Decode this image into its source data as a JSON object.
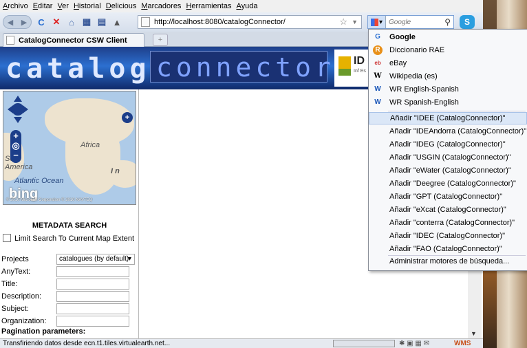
{
  "menubar": {
    "items": [
      "Archivo",
      "Editar",
      "Ver",
      "Historial",
      "Delicious",
      "Marcadores",
      "Herramientas",
      "Ayuda"
    ]
  },
  "navbar": {
    "url": "http://localhost:8080/catalogConnector/",
    "search_placeholder": "Google"
  },
  "tabs": {
    "active_title": "CatalogConnector CSW Client",
    "new_tab_label": "+"
  },
  "banner": {
    "logo_part1": "catalog",
    "logo_part2": "connector",
    "ide_title": "ID",
    "ide_sub": "Inf Es"
  },
  "map": {
    "labels": {
      "africa": "Africa",
      "america": "America",
      "ocean": "Atlantic Ocean",
      "in": "I n",
      "se": "Se"
    },
    "brand": "bing",
    "copyright": "© 2010 Microsoft Corporation   © 2010 NAVTEQ"
  },
  "search": {
    "title": "METADATA SEARCH",
    "limit_label": "Limit Search To Current Map Extent",
    "fields": [
      {
        "label": "Projects",
        "value": "catalogues (by default)"
      },
      {
        "label": "AnyText:"
      },
      {
        "label": "Title:"
      },
      {
        "label": "Description:"
      },
      {
        "label": "Subject:"
      },
      {
        "label": "Organization:"
      }
    ],
    "pagination_label": "Pagination parameters:"
  },
  "status": {
    "text": "Transfiriendo datos desde ecn.t1.tiles.virtualearth.net...",
    "wms": "WMS"
  },
  "dropdown": {
    "engines": [
      {
        "label": "Google",
        "icon": "google-icon"
      },
      {
        "label": "Diccionario RAE",
        "icon": "rae-icon"
      },
      {
        "label": "eBay",
        "icon": "ebay-icon"
      },
      {
        "label": "Wikipedia (es)",
        "icon": "wikipedia-icon"
      },
      {
        "label": "WR English-Spanish",
        "icon": "wordreference-icon"
      },
      {
        "label": "WR Spanish-English",
        "icon": "wordreference-icon"
      }
    ],
    "add_items": [
      "Añadir \"IDEE (CatalogConnector)\"",
      "Añadir \"IDEAndorra (CatalogConnector)\"",
      "Añadir \"IDEG (CatalogConnector)\"",
      "Añadir \"USGIN (CatalogConnector)\"",
      "Añadir \"eWater (CatalogConnector)\"",
      "Añadir \"Deegree (CatalogConnector)\"",
      "Añadir \"GPT (CatalogConnector)\"",
      "Añadir \"eXcat (CatalogConnector)\"",
      "Añadir \"conterra (CatalogConnector)\"",
      "Añadir \"IDEC (CatalogConnector)\"",
      "Añadir \"FAO (CatalogConnector)\""
    ],
    "manage_label": "Administrar motores de búsqueda..."
  }
}
